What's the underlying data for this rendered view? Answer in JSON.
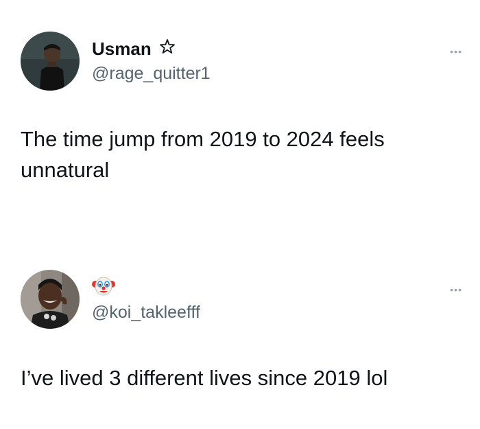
{
  "tweets": [
    {
      "display_name": "Usman",
      "badge_icon": "star-outline-icon",
      "handle": "@rage_quitter1",
      "text": "The time jump from 2019 to 2024 feels unnatural",
      "more_label": "•••"
    },
    {
      "display_name": "",
      "name_icon": "clown-face-icon",
      "handle": "@koi_takleefff",
      "text": "I’ve lived 3 different lives since 2019 lol",
      "more_label": "•••"
    }
  ]
}
